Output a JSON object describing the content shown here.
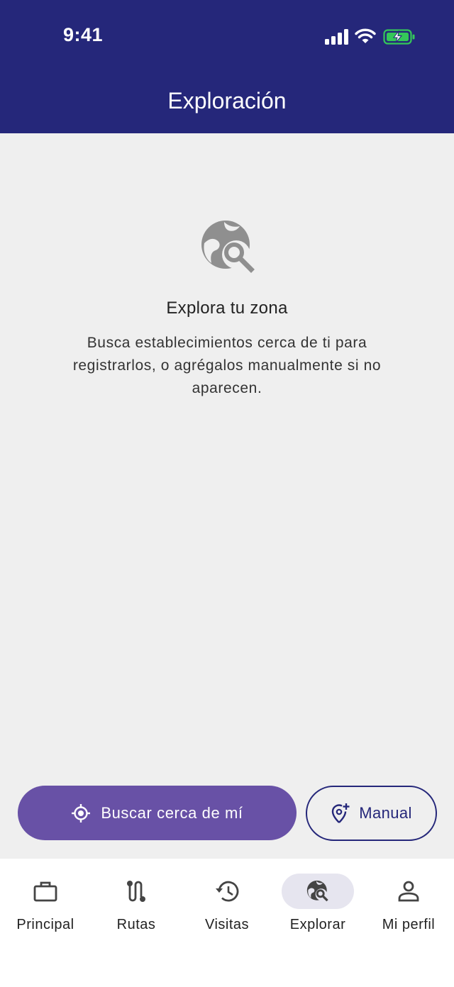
{
  "status_bar": {
    "time": "9:41"
  },
  "header": {
    "title": "Exploración"
  },
  "empty_state": {
    "icon": "travel-explore-icon",
    "title": "Explora tu zona",
    "description": "Busca establecimientos cerca de ti para registrarlos, o agrégalos manualmente si no aparecen."
  },
  "actions": {
    "search_nearby_label": "Buscar cerca de mí",
    "manual_label": "Manual"
  },
  "bottom_nav": {
    "items": [
      {
        "label": "Principal",
        "icon": "briefcase-icon"
      },
      {
        "label": "Rutas",
        "icon": "route-icon"
      },
      {
        "label": "Visitas",
        "icon": "history-icon"
      },
      {
        "label": "Explorar",
        "icon": "travel-explore-icon",
        "active": true
      },
      {
        "label": "Mi perfil",
        "icon": "person-icon"
      }
    ]
  },
  "colors": {
    "header_bg": "#25277a",
    "primary_button": "#6851a6",
    "background": "#efefef",
    "battery": "#34c759"
  }
}
